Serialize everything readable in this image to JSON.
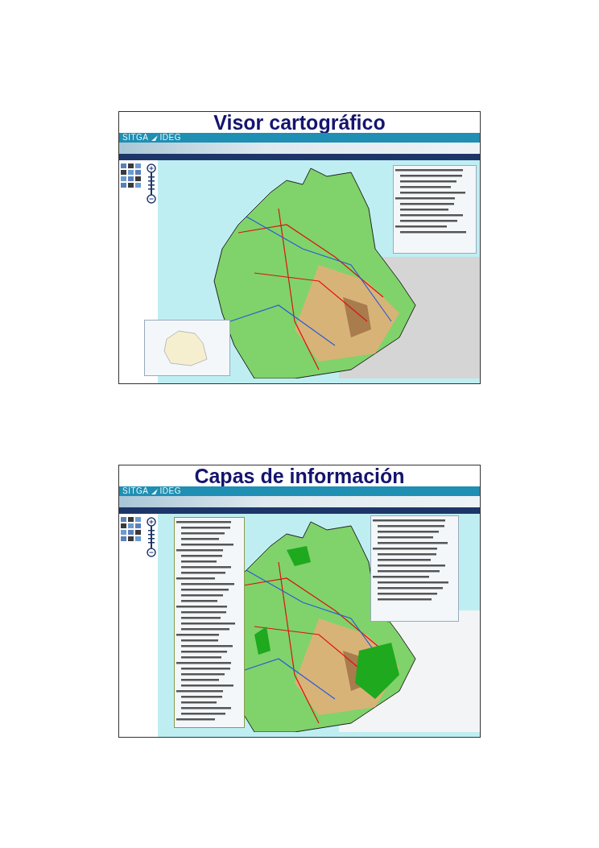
{
  "slides": [
    {
      "title": "Visor cartográfico",
      "kind": "viewer",
      "header": {
        "logo_left": "SITGA",
        "logo_right": "IDEG"
      }
    },
    {
      "title": "Capas de información",
      "kind": "layers",
      "header": {
        "logo_left": "SITGA",
        "logo_right": "IDEG"
      }
    }
  ]
}
